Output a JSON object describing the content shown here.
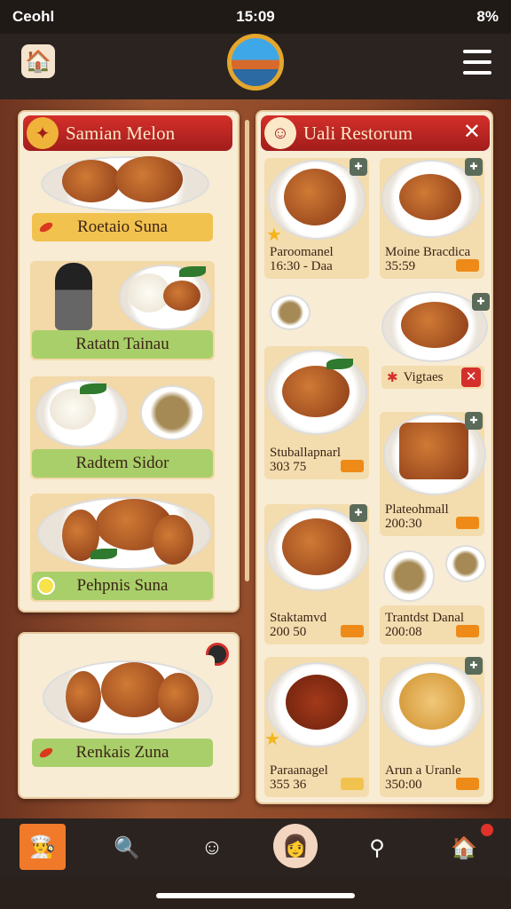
{
  "status": {
    "carrier": "Ceohl",
    "time": "15:09",
    "battery": "8%"
  },
  "left_panel": {
    "title": "Samian Melon",
    "items": [
      "Roetaio Suna",
      "Ratatn Tainau",
      "Radtem Sidor",
      "Pehpnis Suna"
    ]
  },
  "left_bottom": {
    "item": "Renkais Zuna"
  },
  "right_panel": {
    "title": "Uali Restorum",
    "cards": [
      {
        "name": "Paroomanel",
        "detail": "16:30 - Daa"
      },
      {
        "name": "Moine Bracdica",
        "detail": "35:59"
      },
      {
        "name": "Stuballapnarl",
        "detail": "303 75"
      },
      {
        "name": "Plateohmall",
        "detail": "200:30"
      },
      {
        "name": "Staktamvd",
        "detail": "200 50"
      },
      {
        "name": "Trantdst Danal",
        "detail": "200:08"
      },
      {
        "name": "Paraanagel",
        "detail": "355 36"
      },
      {
        "name": "Arun a Uranle",
        "detail": "350:00"
      }
    ],
    "chip": "Vigtaes"
  },
  "colors": {
    "accent": "#c62a24",
    "panel": "#f8ecd5",
    "label_yellow": "#f2c24f",
    "label_green": "#a9cf6a"
  },
  "icons": {
    "logo": "chef-house-icon",
    "menu": "hamburger-icon",
    "close": "close-icon"
  }
}
